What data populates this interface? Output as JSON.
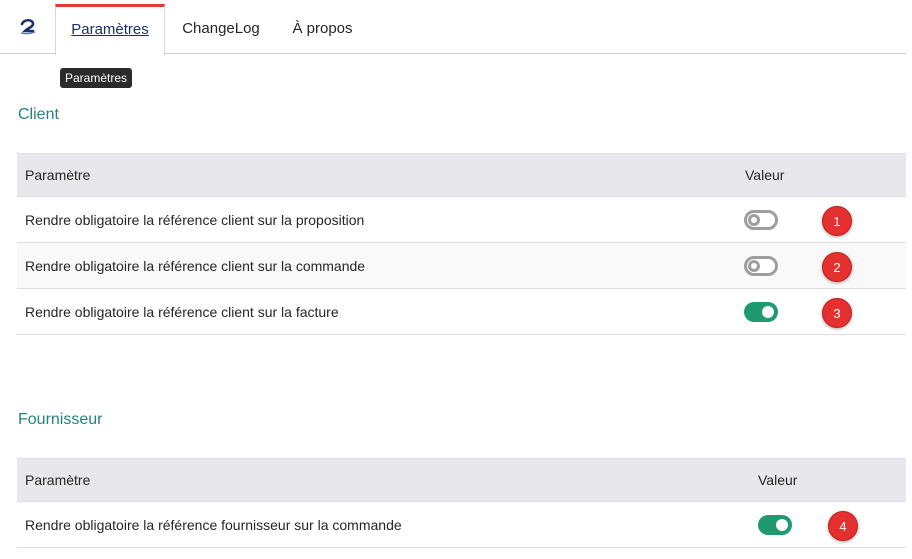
{
  "tabs": [
    {
      "label": "Paramètres",
      "active": true
    },
    {
      "label": "ChangeLog",
      "active": false
    },
    {
      "label": "À propos",
      "active": false
    }
  ],
  "tooltip": "Paramètres",
  "colors": {
    "accent": "#e53935",
    "toggle_on": "#1f9a6f",
    "section_title": "#23857d",
    "badge": "#e53030"
  },
  "client": {
    "title": "Client",
    "headers": {
      "param": "Paramètre",
      "value": "Valeur"
    },
    "rows": [
      {
        "label": "Rendre obligatoire la référence client sur la proposition",
        "enabled": false,
        "badge": "1"
      },
      {
        "label": "Rendre obligatoire la référence client sur la commande",
        "enabled": false,
        "badge": "2"
      },
      {
        "label": "Rendre obligatoire la référence client sur la facture",
        "enabled": true,
        "badge": "3"
      }
    ]
  },
  "fournisseur": {
    "title": "Fournisseur",
    "headers": {
      "param": "Paramètre",
      "value": "Valeur"
    },
    "rows": [
      {
        "label": "Rendre obligatoire la référence fournisseur sur la commande",
        "enabled": true,
        "badge": "4"
      }
    ]
  }
}
